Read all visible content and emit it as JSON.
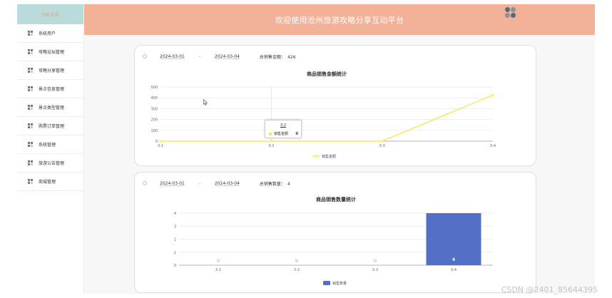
{
  "sidebar": {
    "header": "功能菜单",
    "items": [
      {
        "label": "系统用户",
        "icon": "grid-icon"
      },
      {
        "label": "攻略论坛管理",
        "icon": "grid-icon"
      },
      {
        "label": "攻略分享管理",
        "icon": "grid-icon"
      },
      {
        "label": "景点信息管理",
        "icon": "grid-icon"
      },
      {
        "label": "景点类型管理",
        "icon": "grid-icon"
      },
      {
        "label": "购票订单管理",
        "icon": "grid-icon"
      },
      {
        "label": "系统管理",
        "icon": "grid-icon"
      },
      {
        "label": "旅游公告管理",
        "icon": "grid-icon"
      },
      {
        "label": "商城管理",
        "icon": "grid-icon"
      }
    ]
  },
  "header": {
    "title": "欢迎使用沧州旅游攻略分享互动平台",
    "avatar_icon": "avatar-icon"
  },
  "card1": {
    "start_date": "2024-03-01",
    "separator": "-",
    "end_date": "2024-03-04",
    "stat_label": "总销售金额：",
    "stat_value": "426",
    "tooltip": {
      "title": "3-2",
      "series": "销售金额",
      "value": "0"
    }
  },
  "card2": {
    "start_date": "2024-03-01",
    "separator": "-",
    "end_date": "2024-03-04",
    "stat_label": "总销售数量：",
    "stat_value": "4"
  },
  "chart_data": [
    {
      "type": "line",
      "title": "商品销售金额统计",
      "categories": [
        "3-1",
        "3-2",
        "3-3",
        "3-4"
      ],
      "series": [
        {
          "name": "销售金额",
          "values": [
            0,
            0,
            0,
            426
          ]
        }
      ],
      "ylim": [
        0,
        500
      ],
      "yticks": [
        0,
        100,
        200,
        300,
        400,
        500
      ],
      "grid": true,
      "legend": "bottom-center",
      "color": "#f5e23d"
    },
    {
      "type": "bar",
      "title": "商品销售数量统计",
      "categories": [
        "3-1",
        "3-2",
        "3-3",
        "3-4"
      ],
      "series": [
        {
          "name": "销售数量",
          "values": [
            0,
            0,
            0,
            4
          ]
        }
      ],
      "ylim": [
        0,
        4
      ],
      "yticks": [
        0,
        1,
        2,
        3,
        4
      ],
      "grid": true,
      "legend": "bottom-center",
      "color": "#5470c6"
    }
  ],
  "watermark": "CSDN @2401_85644395"
}
